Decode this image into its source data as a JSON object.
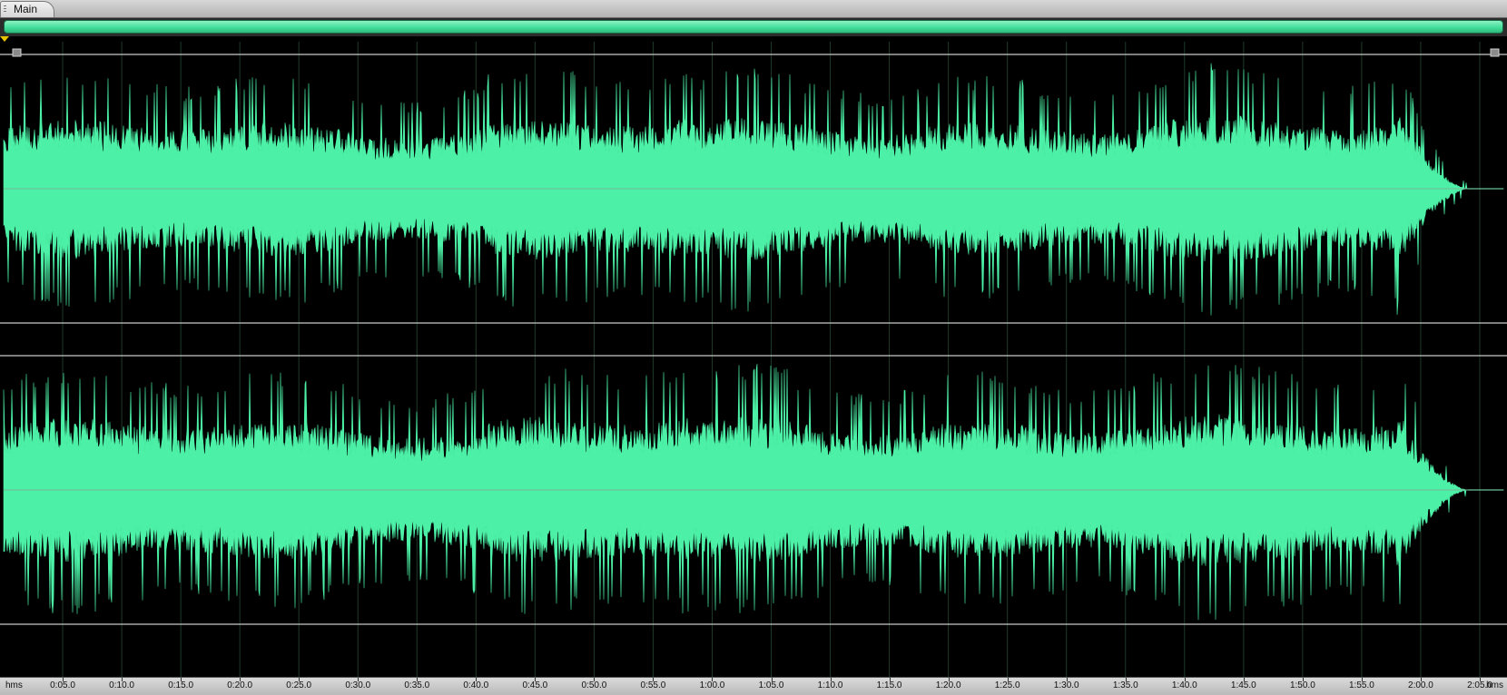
{
  "tabs": [
    {
      "label": "Main",
      "active": true
    }
  ],
  "colors": {
    "waveform": "#4cf0a6",
    "background": "#000000",
    "grid": "#1f3a2a",
    "center_line": "#8a9a92",
    "boundary_line": "#c9c9c9",
    "playhead": "#e6c200"
  },
  "icons": {
    "selection_start": "range-start-marker-icon",
    "selection_end": "range-end-marker-icon",
    "playhead": "playhead-marker-icon"
  },
  "timeline": {
    "unit_left": "hms",
    "unit_right": "hms",
    "labels": [
      "0:05.0",
      "0:10.0",
      "0:15.0",
      "0:20.0",
      "0:25.0",
      "0:30.0",
      "0:35.0",
      "0:40.0",
      "0:45.0",
      "0:50.0",
      "0:55.0",
      "1:00.0",
      "1:05.0",
      "1:10.0",
      "1:15.0",
      "1:20.0",
      "1:25.0",
      "1:30.0",
      "1:35.0",
      "1:40.0",
      "1:45.0",
      "1:50.0",
      "1:55.0",
      "2:00.0",
      "2:05.0"
    ],
    "visible_start_seconds": 0,
    "visible_end_seconds": 127,
    "audio_end_seconds": 124,
    "fade_start_seconds": 118
  },
  "channels": [
    {
      "id": "left",
      "base_amplitude": 0.58,
      "peak_amplitude": 0.95
    },
    {
      "id": "right",
      "base_amplitude": 0.6,
      "peak_amplitude": 0.98
    }
  ]
}
